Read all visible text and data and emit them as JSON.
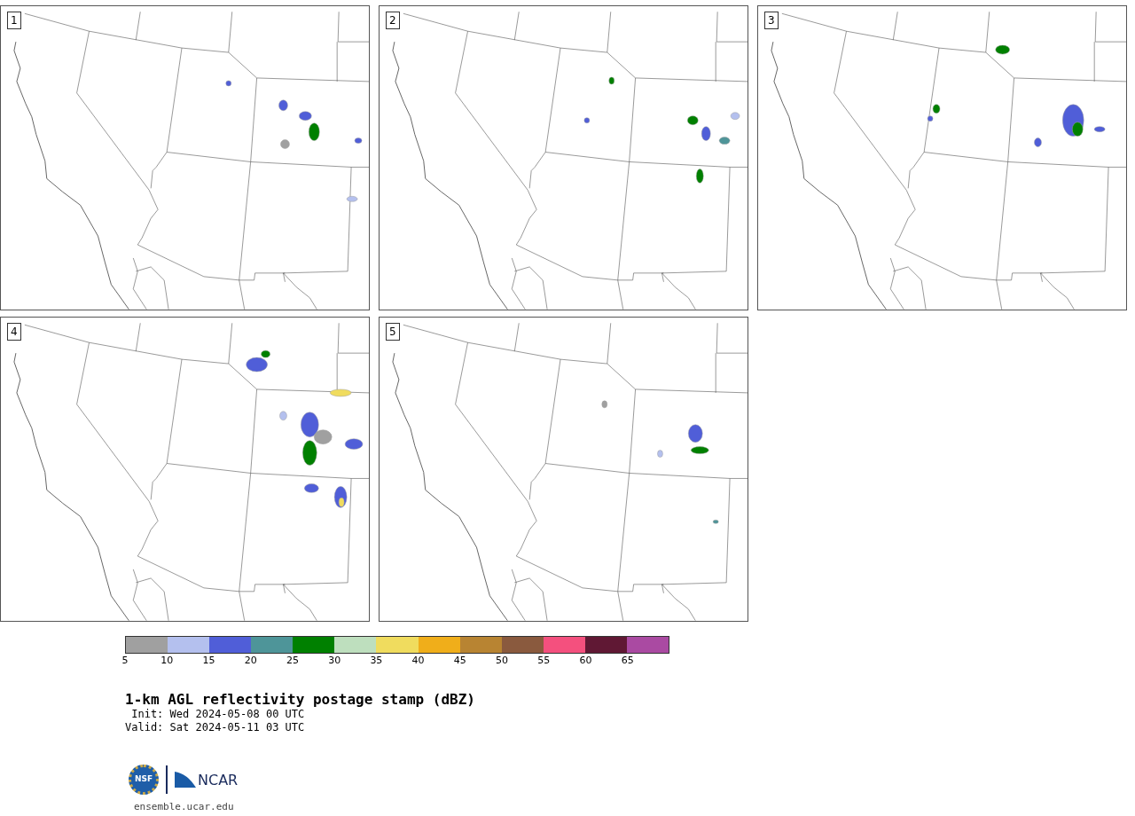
{
  "panels": [
    {
      "label": "1"
    },
    {
      "label": "2"
    },
    {
      "label": "3"
    },
    {
      "label": "4"
    },
    {
      "label": "5"
    }
  ],
  "colorbar": {
    "bins": [
      {
        "label": "5",
        "color": "#a0a0a0"
      },
      {
        "label": "10",
        "color": "#b4c0ee"
      },
      {
        "label": "15",
        "color": "#505ed8"
      },
      {
        "label": "20",
        "color": "#4e9599"
      },
      {
        "label": "25",
        "color": "#008000"
      },
      {
        "label": "30",
        "color": "#bedfbe"
      },
      {
        "label": "35",
        "color": "#f0dc5e"
      },
      {
        "label": "40",
        "color": "#f0ae1a"
      },
      {
        "label": "45",
        "color": "#b88432"
      },
      {
        "label": "50",
        "color": "#8a5a3e"
      },
      {
        "label": "55",
        "color": "#f4507e"
      },
      {
        "label": "60",
        "color": "#601834"
      },
      {
        "label": "65",
        "color": "#aa4aa2"
      }
    ]
  },
  "title": "1-km AGL reflectivity postage stamp (dBZ)",
  "init": " Init: Wed 2024-05-08 00 UTC",
  "valid": "Valid: Sat 2024-05-11 03 UTC",
  "logo": {
    "nsf": "NSF",
    "ncar": "NCAR"
  },
  "footer": "ensemble.ucar.edu"
}
